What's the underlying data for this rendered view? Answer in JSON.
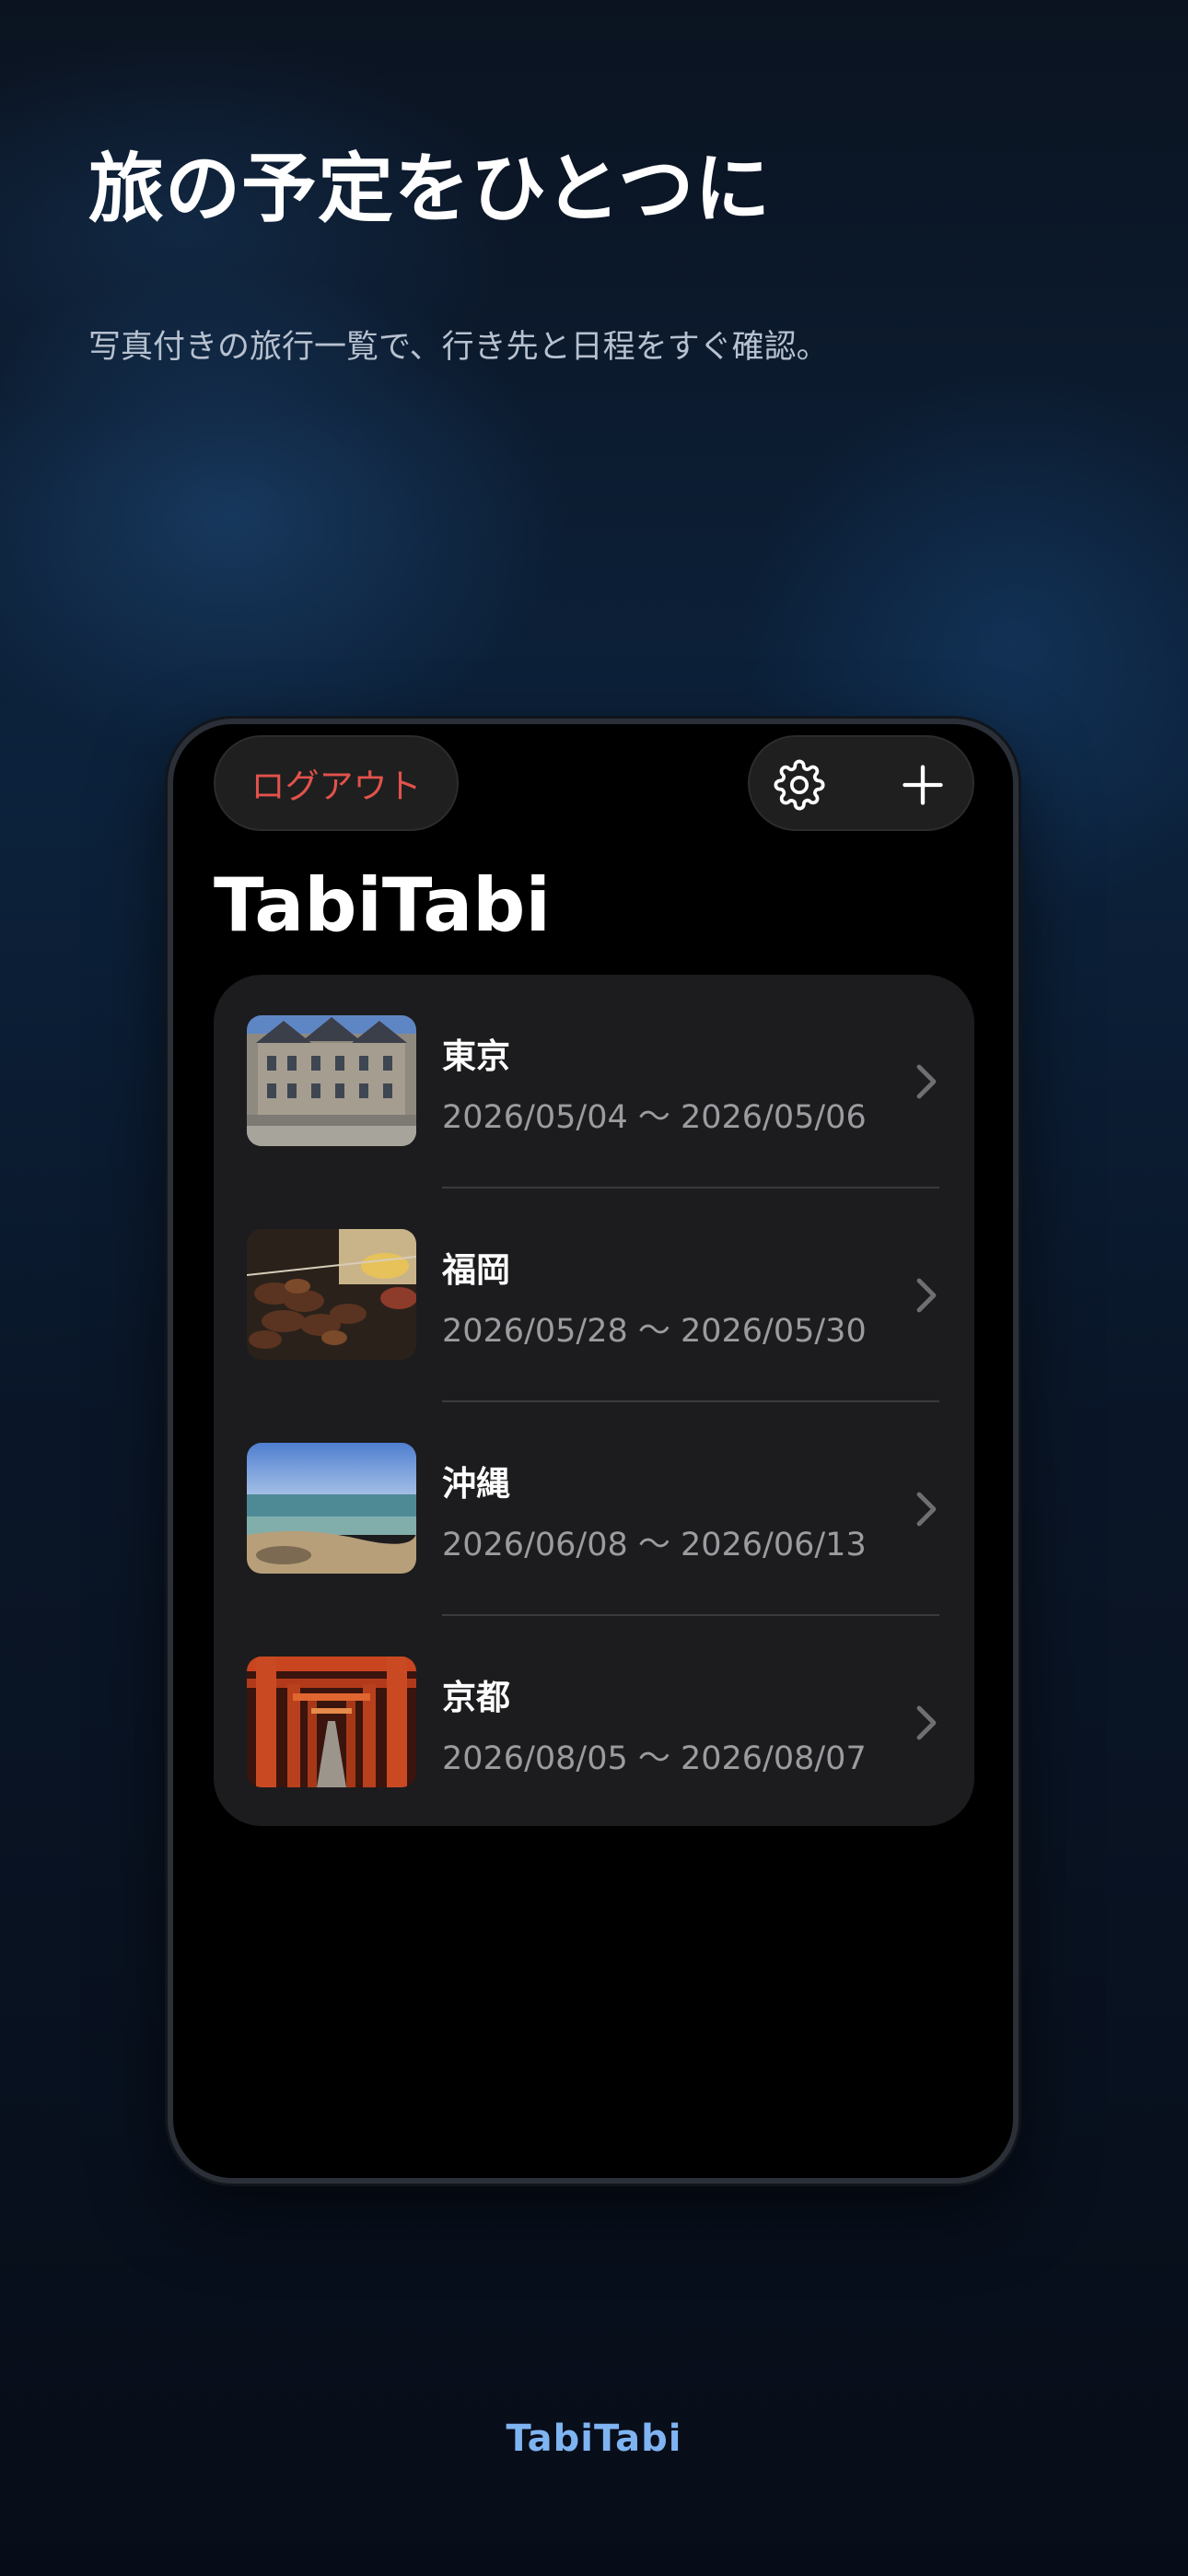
{
  "promo": {
    "headline": "旅の予定をひとつに",
    "subline": "写真付きの旅行一覧で、行き先と日程をすぐ確認。",
    "footer_brand": "TabiTabi"
  },
  "app": {
    "logout_label": "ログアウト",
    "settings_icon": "gear-icon",
    "add_icon": "plus-icon",
    "title": "TabiTabi",
    "trips": [
      {
        "name": "東京",
        "dates": "2026/05/04 〜 2026/05/06",
        "thumbnail": "palace-building-photo"
      },
      {
        "name": "福岡",
        "dates": "2026/05/28 〜 2026/05/30",
        "thumbnail": "yakitori-food-photo"
      },
      {
        "name": "沖縄",
        "dates": "2026/06/08 〜 2026/06/13",
        "thumbnail": "beach-sea-photo"
      },
      {
        "name": "京都",
        "dates": "2026/08/05 〜 2026/08/07",
        "thumbnail": "torii-gates-photo"
      }
    ]
  },
  "colors": {
    "logout_text": "#e2524b",
    "brand_accent": "#7fb4f2",
    "card_background": "#1c1c1e",
    "secondary_text": "#9b9ba0"
  }
}
